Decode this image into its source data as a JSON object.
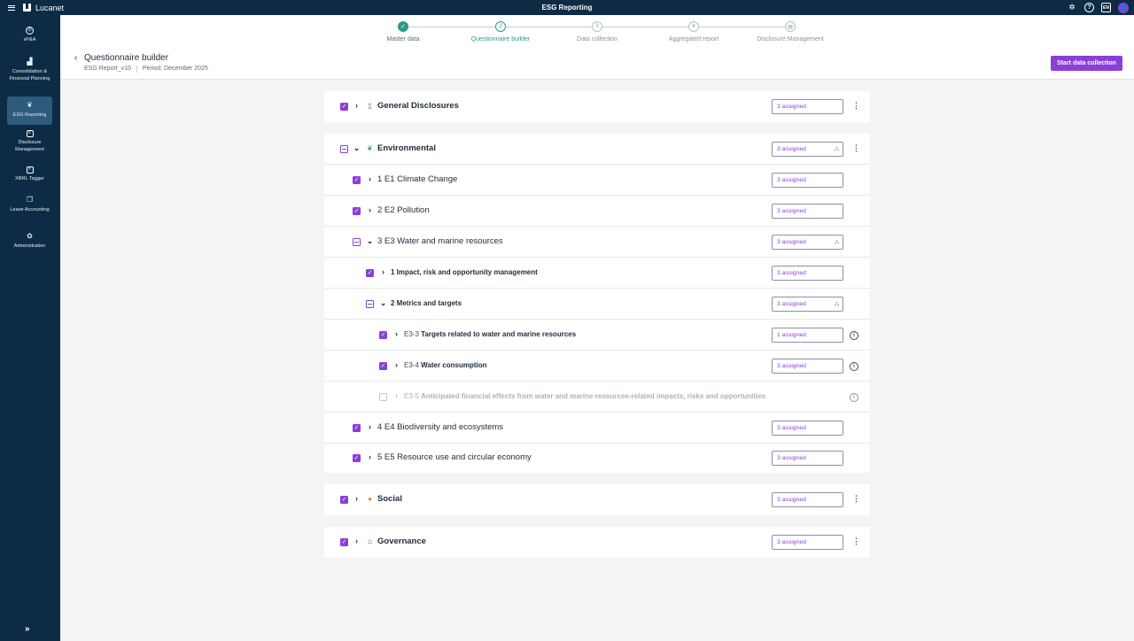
{
  "topbar": {
    "brand": "Lucanet",
    "app_title": "ESG Reporting",
    "avatar_initial": "👤"
  },
  "sidebar": {
    "items": [
      {
        "label": "xP&A",
        "icon": "compass-icon",
        "active": false
      },
      {
        "label": "Consolidation & Financial Planning",
        "icon": "chart-icon",
        "active": false
      },
      {
        "label": "ESG Reporting",
        "icon": "leaf-icon",
        "active": true
      },
      {
        "label": "Disclosure Management",
        "icon": "document-icon",
        "active": false
      },
      {
        "label": "XBRL Tagger",
        "icon": "tag-icon",
        "active": false
      },
      {
        "label": "Lease Accounting",
        "icon": "copy-icon",
        "active": false
      },
      {
        "label": "Administration",
        "icon": "gear-icon",
        "active": false
      }
    ],
    "expand_label": "»"
  },
  "stepper": {
    "steps": [
      {
        "number": "✓",
        "label": "Master data",
        "state": "done"
      },
      {
        "number": "2",
        "label": "Questionnaire builder",
        "state": "current"
      },
      {
        "number": "3",
        "label": "Data collection",
        "state": "upcoming"
      },
      {
        "number": "4",
        "label": "Aggregated report",
        "state": "upcoming"
      },
      {
        "number": "▤",
        "label": "Disclosure Management",
        "state": "upcoming"
      }
    ]
  },
  "header": {
    "back_label": "‹",
    "title": "Questionnaire builder",
    "report": "ESG Report_v10",
    "period": "Period: December 2025",
    "start_button": "Start data collection"
  },
  "sections": {
    "general": {
      "label": "General Disclosures",
      "assigned": "3 assigned",
      "checkbox": "checked",
      "icon": "document-icon"
    },
    "environmental": {
      "label": "Environmental",
      "assigned": "3 assigned",
      "checkbox": "indeterminate",
      "icon": "leaf-icon"
    },
    "social": {
      "label": "Social",
      "assigned": "3 assigned",
      "checkbox": "checked",
      "icon": "person-icon"
    },
    "governance": {
      "label": "Governance",
      "assigned": "3 assigned",
      "checkbox": "checked",
      "icon": "bank-icon"
    }
  },
  "env_rows": {
    "e1": {
      "label": "1 E1 Climate Change",
      "assigned": "3 assigned"
    },
    "e2": {
      "label": "2 E2 Pollution",
      "assigned": "3 assigned"
    },
    "e3": {
      "label": "3 E3 Water and marine resources",
      "assigned": "3 assigned"
    },
    "e3_1": {
      "label": "1 Impact, risk and opportunity management",
      "assigned": "3 assigned"
    },
    "e3_2": {
      "label": "2 Metrics and targets",
      "assigned": "3 assigned"
    },
    "e3_3": {
      "code": "E3-3",
      "label": "Targets related to water and marine resources",
      "assigned": "1 assigned"
    },
    "e3_4": {
      "code": "E3-4",
      "label": "Water consumption",
      "assigned": "3 assigned"
    },
    "e3_5": {
      "code": "E3-5",
      "label": "Anticipated financial effects from water and marine resources-related impacts, risks and opportunities"
    },
    "e4": {
      "label": "4 E4 Biodiversity and ecosystems",
      "assigned": "3 assigned"
    },
    "e5": {
      "label": "5 E5 Resource use and circular economy",
      "assigned": "3 assigned"
    }
  },
  "colors": {
    "accent": "#8b3fd9",
    "nav_bg": "#0d2b44",
    "step_done": "#2a9a8a"
  }
}
